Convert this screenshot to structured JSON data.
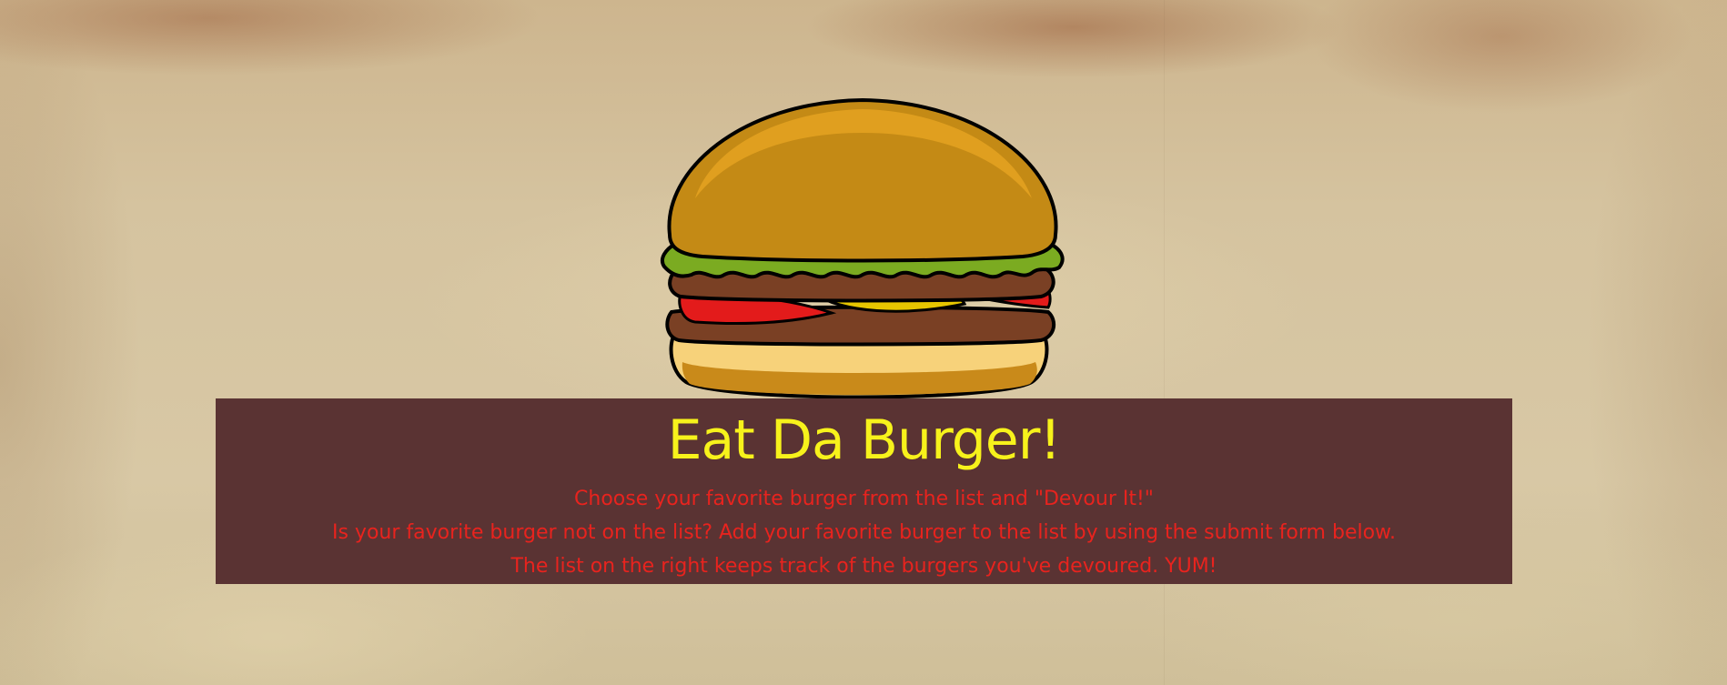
{
  "header": {
    "title": "Eat Da Burger!",
    "lines": [
      "Choose your favorite burger from the list and \"Devour It!\"",
      "Is your favorite burger not on the list? Add your favorite burger to the list by using the submit form below.",
      "The list on the right keeps track of the burgers you've devoured. YUM!"
    ]
  },
  "images": {
    "logo_icon": "burger-icon"
  },
  "colors": {
    "banner_bg": "#5a3333",
    "title": "#f7f21b",
    "body_text": "#e8231e",
    "page_bg": "#d6c6a1"
  }
}
